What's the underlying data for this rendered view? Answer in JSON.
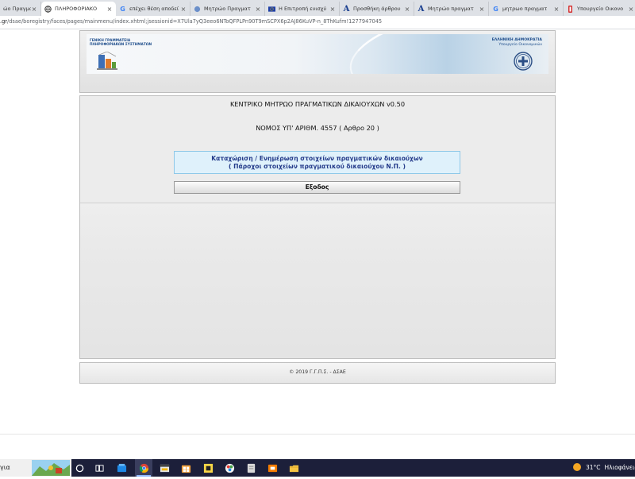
{
  "browser": {
    "tabs": [
      {
        "label": "ώο Πραγμα",
        "icon": "tab-page-icon",
        "active": false
      },
      {
        "label": "ΠΛΗΡΟΦΟΡΙΑΚΟ",
        "icon": "globe-icon",
        "active": true
      },
      {
        "label": "επέχει θέση αποδεί",
        "icon": "google-icon",
        "active": false
      },
      {
        "label": "Μητρώο Πραγματ",
        "icon": "site-icon",
        "active": false
      },
      {
        "label": "Η Επιτροπή ενισχύ",
        "icon": "eu-flag-icon",
        "active": false
      },
      {
        "label": "Προσθήκη άρθρου",
        "icon": "letter-a-icon",
        "active": false
      },
      {
        "label": "Μητρώο πραγματ",
        "icon": "letter-a-icon",
        "active": false
      },
      {
        "label": "μητρωο πραγματ",
        "icon": "google-icon",
        "active": false
      },
      {
        "label": "Υπουργείο Οικονο",
        "icon": "ministry-icon",
        "active": false
      }
    ],
    "new_tab": "+",
    "url_host": ".gr",
    "url_path": "/dsae/boregistry/faces/pages/mainmenu/index.xhtml;jsessionid=X7Ula7yQ3eeo6NToQFPLPn90T9mSCPX6p2AJ86KuVP-n_8ThKufm!1277947045"
  },
  "header": {
    "gsis_line1": "ΓΕΝΙΚΗ ΓΡΑΜΜΑΤΕΙΑ",
    "gsis_line2": "ΠΛΗΡΟΦΟΡΙΑΚΩΝ ΣΥΣΤΗΜΑΤΩΝ",
    "republic": "ΕΛΛΗΝΙΚΗ ΔΗΜΟΚΡΑΤΙΑ",
    "ministry": "Υπουργείο Οικονομικών"
  },
  "main": {
    "title": "ΚΕΝΤΡΙΚΟ ΜΗΤΡΩΟ ΠΡΑΓΜΑΤΙΚΩΝ ΔΙΚΑΙΟΥΧΩΝ v0.50",
    "law": "ΝΟΜΟΣ ΥΠ' ΑΡΙΘΜ. 4557 ( Αρθρο 20 )",
    "register_line1": "Καταχώριση / Ενημέρωση στοιχείων πραγματικών δικαιούχων",
    "register_line2": "( Πάροχοι στοιχείων πραγματικού δικαιούχου Ν.Π. )",
    "exit_label": "Εξοδος"
  },
  "footer": {
    "text": "© 2019 Γ.Γ.Π.Σ. - ΔΣΑΕ"
  },
  "taskbar": {
    "search_text": "για",
    "weather_temp": "31°C",
    "weather_desc": "Ηλιοφάνεια"
  },
  "colors": {
    "register_bg": "#dff1fb",
    "register_border": "#8ec8e8",
    "register_text": "#243b8a",
    "taskbar_bg": "#1c1f3a"
  }
}
